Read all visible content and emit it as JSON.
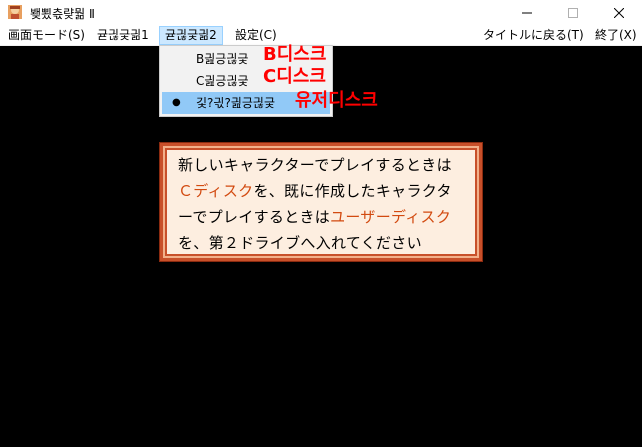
{
  "window": {
    "title": "뵂뾨츣럊뭚 Ⅱ"
  },
  "menubar": {
    "items": [
      {
        "label": "画面モード(S)"
      },
      {
        "label": "귣긚긏긞1"
      },
      {
        "label": "귣긚긏긞2"
      },
      {
        "label": "設定(C)"
      },
      {
        "label": "タイトルに戻る(T)"
      },
      {
        "label": "終了(X)"
      }
    ]
  },
  "dropdown": {
    "items": [
      {
        "label": "B긢긍긚긏",
        "annotation": "B디스크"
      },
      {
        "label": "C긢긍긚긏",
        "annotation": "C디스크"
      },
      {
        "label": "깇?긗?긢긍긚긏",
        "annotation": "유저디스크",
        "bullet": "●"
      }
    ]
  },
  "message": {
    "line1": "新しいキャラクターでプレイするときは",
    "line2_hl": "Ｃディスク",
    "line2_rest": "を、既に作成したキャラクタ",
    "line3_start": "ーでプレイするときは",
    "line3_hl": "ユーザーディスク",
    "line4": "を、第２ドライブへ入れてください"
  },
  "colors": {
    "highlight_text": "#d24a10",
    "annotation": "#ff0000",
    "menu_active": "#cce8ff",
    "selected_item": "#91c9f7"
  },
  "icons": {
    "app": "app-icon",
    "minimize": "minimize-icon",
    "maximize": "maximize-icon",
    "close": "close-icon"
  }
}
